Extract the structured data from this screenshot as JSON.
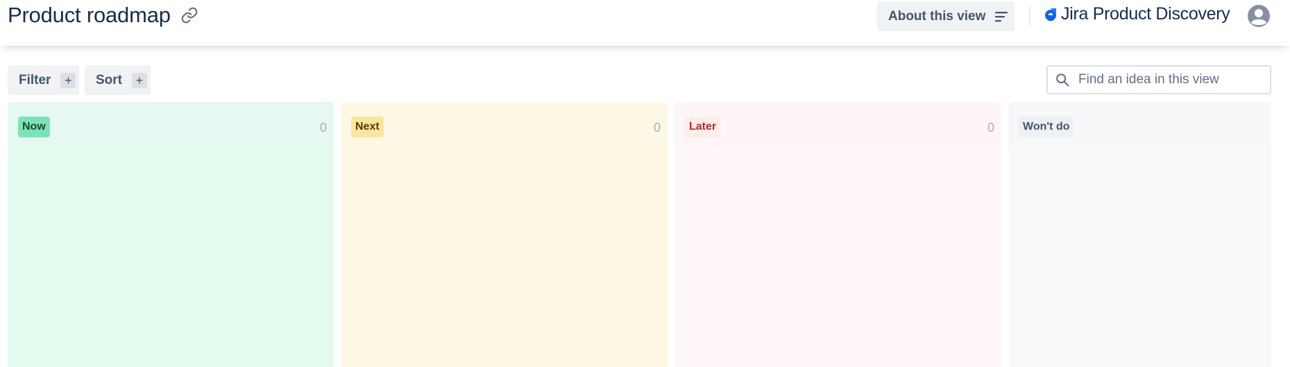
{
  "header": {
    "title": "Product roadmap",
    "about_label": "About this view",
    "brand": "Jira Product Discovery",
    "icons": {
      "link": "link-icon",
      "about": "menu-lines-icon",
      "brand": "jira-product-discovery-logo",
      "avatar": "user-avatar-icon"
    }
  },
  "toolbar": {
    "filter_label": "Filter",
    "sort_label": "Sort",
    "plus": "+",
    "search": {
      "placeholder": "Find an idea in this view",
      "value": ""
    }
  },
  "columns": [
    {
      "label": "Now",
      "count": "0",
      "color": "#7ee2b8"
    },
    {
      "label": "Next",
      "count": "0",
      "color": "#f8e6a0"
    },
    {
      "label": "Later",
      "count": "0",
      "color": "#ffeceb"
    },
    {
      "label": "Won't do",
      "count": "",
      "color": "#eef0f2"
    }
  ],
  "colors": {
    "accent": "#0c66e4",
    "text": "#172b4d",
    "subtle_text": "#44546f"
  }
}
